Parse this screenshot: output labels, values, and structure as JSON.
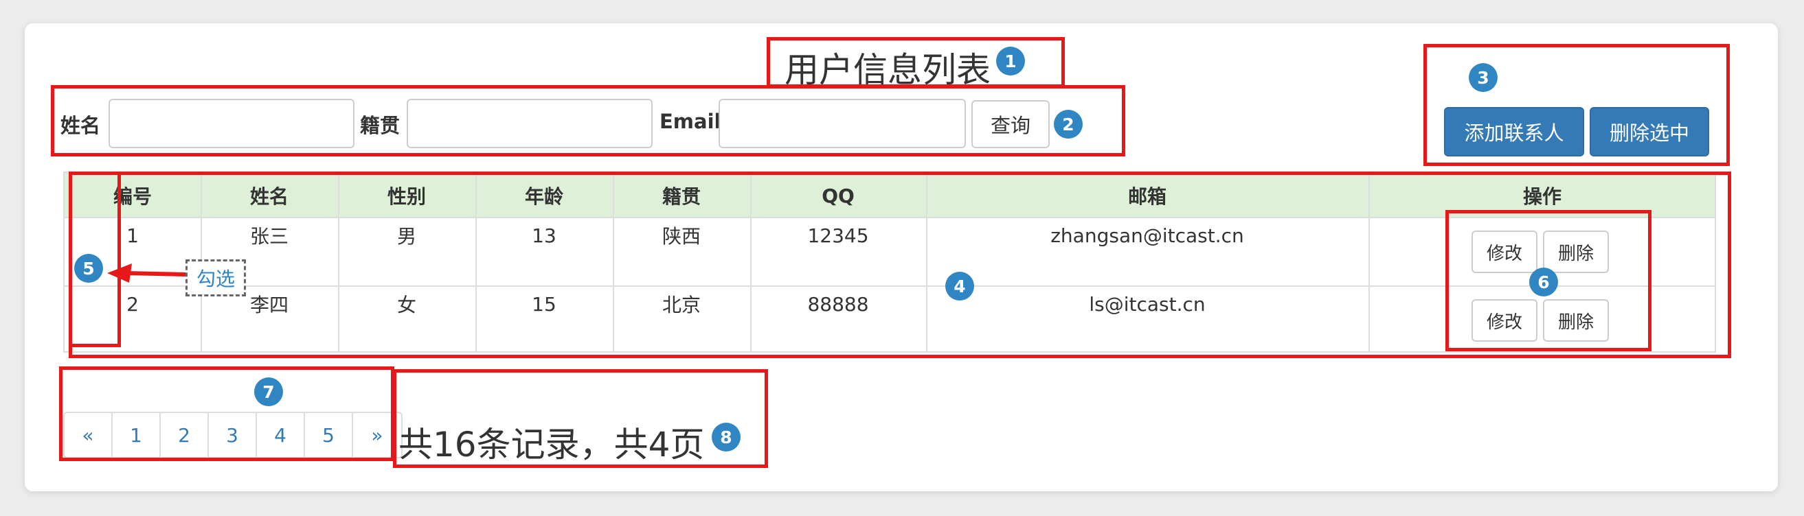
{
  "title": "用户信息列表",
  "search": {
    "name_label": "姓名",
    "origin_label": "籍贯",
    "email_label": "Email",
    "name_value": "",
    "origin_value": "",
    "email_value": "",
    "query_button": "查询"
  },
  "actions": {
    "add_contact": "添加联系人",
    "delete_selected": "删除选中"
  },
  "table": {
    "columns": [
      "编号",
      "姓名",
      "性别",
      "年龄",
      "籍贯",
      "QQ",
      "邮箱",
      "操作"
    ],
    "rows": [
      {
        "id": "1",
        "name": "张三",
        "gender": "男",
        "age": "13",
        "origin": "陕西",
        "qq": "12345",
        "email": "zhangsan@itcast.cn",
        "edit": "修改",
        "delete": "删除"
      },
      {
        "id": "2",
        "name": "李四",
        "gender": "女",
        "age": "15",
        "origin": "北京",
        "qq": "88888",
        "email": "ls@itcast.cn",
        "edit": "修改",
        "delete": "删除"
      }
    ]
  },
  "callout": "勾选",
  "pagination": [
    "«",
    "1",
    "2",
    "3",
    "4",
    "5",
    "»"
  ],
  "summary": "共16条记录，共4页",
  "badges": [
    "1",
    "2",
    "3",
    "4",
    "5",
    "6",
    "7",
    "8"
  ],
  "colors": {
    "highlight_red": "#e81818",
    "badge_blue": "#2f86c2",
    "primary_button": "#337ab7",
    "table_header_bg": "#dff0d8"
  }
}
